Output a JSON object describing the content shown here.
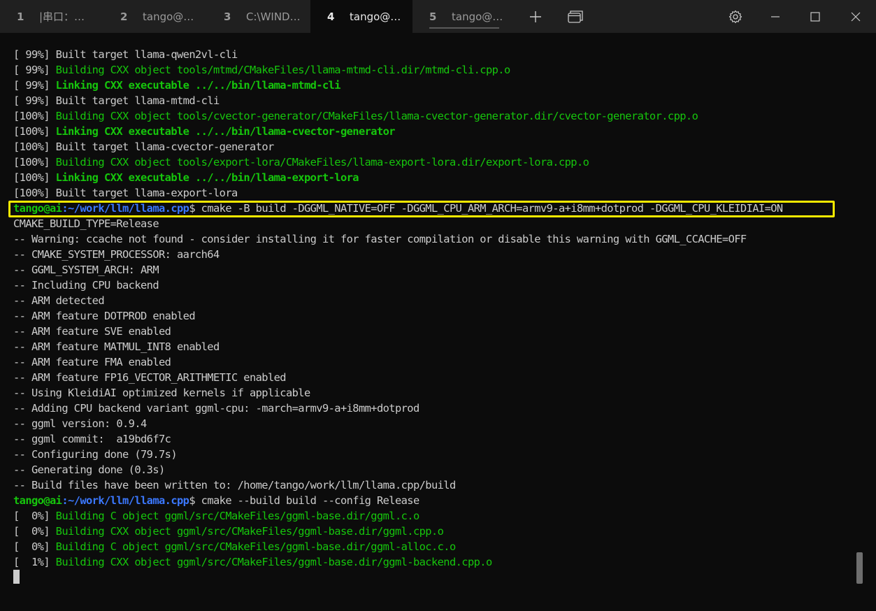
{
  "tabs": [
    {
      "num": "1",
      "title": "|串口：…",
      "active": false
    },
    {
      "num": "2",
      "title": "tango@…",
      "active": false
    },
    {
      "num": "3",
      "title": "C:\\WIND…",
      "active": false
    },
    {
      "num": "4",
      "title": "tango@…",
      "active": true
    },
    {
      "num": "5",
      "title": "tango@…",
      "active": false
    }
  ],
  "titlebar_icons": [
    "plus-icon",
    "window-icon",
    "gear-icon",
    "minimize-icon",
    "maximize-icon",
    "close-icon"
  ],
  "colors": {
    "green": "#16c60c",
    "path_blue": "#3b78ff",
    "text": "#cccccc",
    "highlight": "#f5e800",
    "background": "#0c0c0c"
  },
  "lines": [
    {
      "pre": "[ 99%] ",
      "text": "Built target llama-qwen2vl-cli",
      "style": "plain"
    },
    {
      "pre": "[ 99%] ",
      "text": "Building CXX object tools/mtmd/CMakeFiles/llama-mtmd-cli.dir/mtmd-cli.cpp.o",
      "style": "green"
    },
    {
      "pre": "[ 99%] ",
      "text": "Linking CXX executable ../../bin/llama-mtmd-cli",
      "style": "green-bold"
    },
    {
      "pre": "[ 99%] ",
      "text": "Built target llama-mtmd-cli",
      "style": "plain"
    },
    {
      "pre": "[100%] ",
      "text": "Building CXX object tools/cvector-generator/CMakeFiles/llama-cvector-generator.dir/cvector-generator.cpp.o",
      "style": "green"
    },
    {
      "pre": "[100%] ",
      "text": "Linking CXX executable ../../bin/llama-cvector-generator",
      "style": "green-bold"
    },
    {
      "pre": "[100%] ",
      "text": "Built target llama-cvector-generator",
      "style": "plain"
    },
    {
      "pre": "[100%] ",
      "text": "Building CXX object tools/export-lora/CMakeFiles/llama-export-lora.dir/export-lora.cpp.o",
      "style": "green"
    },
    {
      "pre": "[100%] ",
      "text": "Linking CXX executable ../../bin/llama-export-lora",
      "style": "green-bold"
    },
    {
      "pre": "[100%] ",
      "text": "Built target llama-export-lora",
      "style": "plain"
    },
    {
      "prompt_user": "tango@ai",
      "prompt_path": ":~/work/llm/llama.cpp",
      "text": "$ cmake -B build -DGGML_NATIVE=OFF -DGGML_CPU_ARM_ARCH=armv9-a+i8mm+dotprod -DGGML_CPU_KLEIDIAI=ON",
      "style": "prompt"
    },
    {
      "pre": "",
      "text": "CMAKE_BUILD_TYPE=Release",
      "style": "plain"
    },
    {
      "pre": "",
      "text": "-- Warning: ccache not found - consider installing it for faster compilation or disable this warning with GGML_CCACHE=OFF",
      "style": "plain"
    },
    {
      "pre": "",
      "text": "-- CMAKE_SYSTEM_PROCESSOR: aarch64",
      "style": "plain"
    },
    {
      "pre": "",
      "text": "-- GGML_SYSTEM_ARCH: ARM",
      "style": "plain"
    },
    {
      "pre": "",
      "text": "-- Including CPU backend",
      "style": "plain"
    },
    {
      "pre": "",
      "text": "-- ARM detected",
      "style": "plain"
    },
    {
      "pre": "",
      "text": "-- ARM feature DOTPROD enabled",
      "style": "plain"
    },
    {
      "pre": "",
      "text": "-- ARM feature SVE enabled",
      "style": "plain"
    },
    {
      "pre": "",
      "text": "-- ARM feature MATMUL_INT8 enabled",
      "style": "plain"
    },
    {
      "pre": "",
      "text": "-- ARM feature FMA enabled",
      "style": "plain"
    },
    {
      "pre": "",
      "text": "-- ARM feature FP16_VECTOR_ARITHMETIC enabled",
      "style": "plain"
    },
    {
      "pre": "",
      "text": "-- Using KleidiAI optimized kernels if applicable",
      "style": "plain"
    },
    {
      "pre": "",
      "text": "-- Adding CPU backend variant ggml-cpu: -march=armv9-a+i8mm+dotprod",
      "style": "plain"
    },
    {
      "pre": "",
      "text": "-- ggml version: 0.9.4",
      "style": "plain"
    },
    {
      "pre": "",
      "text": "-- ggml commit:  a19bd6f7c",
      "style": "plain"
    },
    {
      "pre": "",
      "text": "-- Configuring done (79.7s)",
      "style": "plain"
    },
    {
      "pre": "",
      "text": "-- Generating done (0.3s)",
      "style": "plain"
    },
    {
      "pre": "",
      "text": "-- Build files have been written to: /home/tango/work/llm/llama.cpp/build",
      "style": "plain"
    },
    {
      "prompt_user": "tango@ai",
      "prompt_path": ":~/work/llm/llama.cpp",
      "text": "$ cmake --build build --config Release",
      "style": "prompt"
    },
    {
      "pre": "[  0%] ",
      "text": "Building C object ggml/src/CMakeFiles/ggml-base.dir/ggml.c.o",
      "style": "green"
    },
    {
      "pre": "[  0%] ",
      "text": "Building CXX object ggml/src/CMakeFiles/ggml-base.dir/ggml.cpp.o",
      "style": "green"
    },
    {
      "pre": "[  0%] ",
      "text": "Building C object ggml/src/CMakeFiles/ggml-base.dir/ggml-alloc.c.o",
      "style": "green"
    },
    {
      "pre": "[  1%] ",
      "text": "Building CXX object ggml/src/CMakeFiles/ggml-base.dir/ggml-backend.cpp.o",
      "style": "green"
    }
  ]
}
